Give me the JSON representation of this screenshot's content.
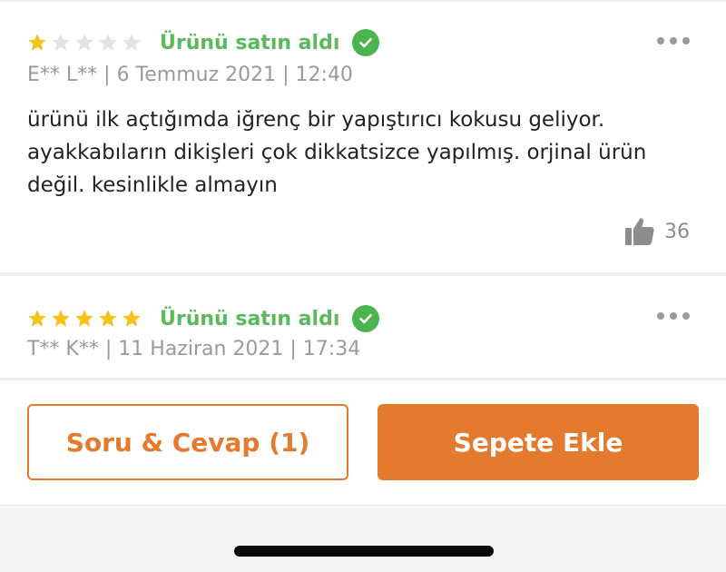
{
  "reviews": [
    {
      "rating": 1,
      "max_rating": 5,
      "verified_label": "Ürünü satın aldı",
      "author": "E** L**",
      "date": "6 Temmuz 2021",
      "time": "12:40",
      "text": "ürünü ilk açtığımda iğrenç bir yapıştırıcı kokusu geliyor. ayakkabıların dikişleri çok dikkatsizce yapılmış. orjinal ürün değil. kesinlikle almayın",
      "likes": "36"
    },
    {
      "rating": 5,
      "max_rating": 5,
      "verified_label": "Ürünü satın aldı",
      "author": "T** K**",
      "date": "11 Haziran 2021",
      "time": "17:34"
    }
  ],
  "buttons": {
    "qa_label": "Soru & Cevap (1)",
    "add_to_cart_label": "Sepete Ekle"
  },
  "colors": {
    "star_filled": "#f4c21d",
    "star_empty": "#e3e3e3",
    "verified_green": "#5cb85c",
    "accent_orange": "#e47a2e"
  },
  "icons": [
    "star-icon",
    "check-circle-icon",
    "more-icon",
    "thumbs-up-icon"
  ]
}
